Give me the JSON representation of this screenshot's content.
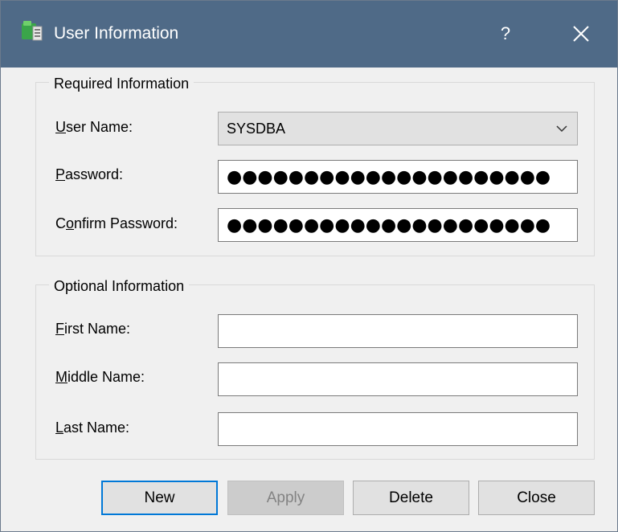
{
  "window": {
    "title": "User Information",
    "help_glyph": "?",
    "close_glyph": "✕",
    "app_icon": "server-icon"
  },
  "required": {
    "legend": "Required Information",
    "user_name": {
      "label_access": "U",
      "label_rest": "ser Name:",
      "value": "SYSDBA"
    },
    "password": {
      "label_access": "P",
      "label_rest": "assword:",
      "masked_value": "●●●●●●●●●●●●●●●●●●●●●"
    },
    "confirm_password": {
      "label_pre": "C",
      "label_access": "o",
      "label_rest": "nfirm Password:",
      "masked_value": "●●●●●●●●●●●●●●●●●●●●●"
    }
  },
  "optional": {
    "legend": "Optional Information",
    "first_name": {
      "label_access": "F",
      "label_rest": "irst Name:",
      "value": ""
    },
    "middle_name": {
      "label_access": "M",
      "label_rest": "iddle Name:",
      "value": ""
    },
    "last_name": {
      "label_access": "L",
      "label_rest": "ast Name:",
      "value": ""
    }
  },
  "buttons": {
    "new": "New",
    "apply": "Apply",
    "delete": "Delete",
    "close": "Close"
  },
  "colors": {
    "titlebar": "#4f6a87",
    "focus_accent": "#0078d7",
    "dialog_bg": "#f0f0f0"
  }
}
